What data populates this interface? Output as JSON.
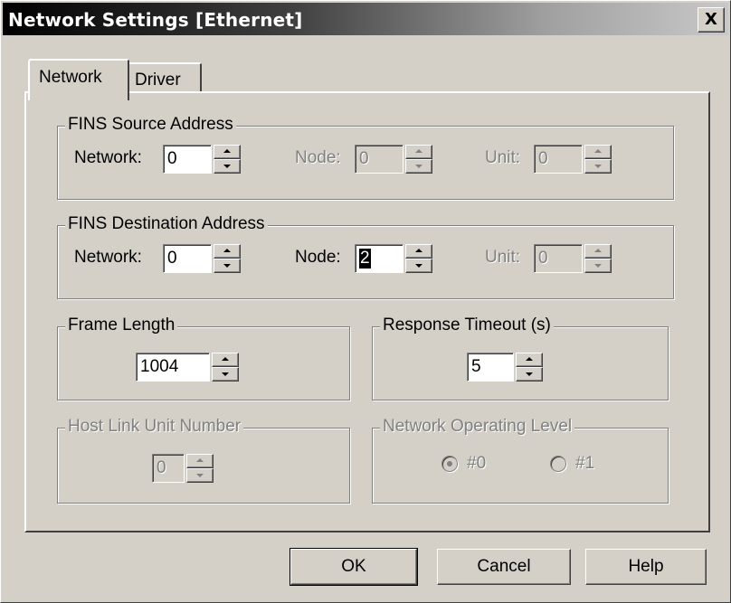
{
  "window": {
    "title": "Network Settings [Ethernet]",
    "close_symbol": "X"
  },
  "tabs": [
    {
      "label": "Network",
      "active": true
    },
    {
      "label": "Driver",
      "active": false
    }
  ],
  "fins_source": {
    "title": "FINS Source Address",
    "network_label": "Network:",
    "network_value": "0",
    "node_label": "Node:",
    "node_value": "0",
    "unit_label": "Unit:",
    "unit_value": "0"
  },
  "fins_destination": {
    "title": "FINS Destination Address",
    "network_label": "Network:",
    "network_value": "0",
    "node_label": "Node:",
    "node_value": "2",
    "unit_label": "Unit:",
    "unit_value": "0"
  },
  "frame_length": {
    "title": "Frame Length",
    "value": "1004"
  },
  "response_timeout": {
    "title": "Response Timeout (s)",
    "value": "5"
  },
  "host_link": {
    "title": "Host Link Unit Number",
    "value": "0"
  },
  "network_level": {
    "title": "Network Operating Level",
    "options": [
      {
        "label": "#0",
        "selected": true
      },
      {
        "label": "#1",
        "selected": false
      }
    ]
  },
  "buttons": {
    "ok": "OK",
    "cancel": "Cancel",
    "help": "Help"
  },
  "icons": {
    "close": "close-icon",
    "spin_up": "arrow-up-icon",
    "spin_down": "arrow-down-icon"
  }
}
